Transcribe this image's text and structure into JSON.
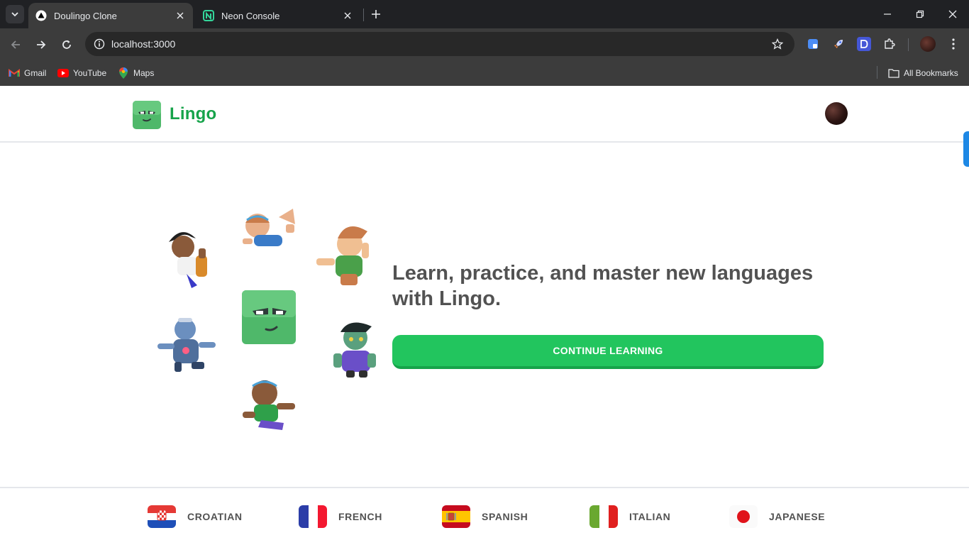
{
  "browser": {
    "tabs": [
      {
        "title": "Doulingo Clone",
        "active": true
      },
      {
        "title": "Neon Console",
        "active": false
      }
    ],
    "url": "localhost:3000",
    "bookmarks": [
      {
        "label": "Gmail",
        "icon": "gmail-icon"
      },
      {
        "label": "YouTube",
        "icon": "youtube-icon"
      },
      {
        "label": "Maps",
        "icon": "maps-icon"
      }
    ],
    "all_bookmarks_label": "All Bookmarks"
  },
  "header": {
    "logo_text": "Lingo"
  },
  "hero": {
    "headline": "Learn, practice, and master new languages with Lingo.",
    "cta_label": "CONTINUE LEARNING"
  },
  "footer": {
    "languages": [
      {
        "label": "CROATIAN",
        "flag": "croatia-flag"
      },
      {
        "label": "FRENCH",
        "flag": "france-flag"
      },
      {
        "label": "SPANISH",
        "flag": "spain-flag"
      },
      {
        "label": "ITALIAN",
        "flag": "italy-flag"
      },
      {
        "label": "JAPANESE",
        "flag": "japan-flag"
      }
    ]
  },
  "colors": {
    "brand_green": "#16a34a",
    "button_green": "#22c55e",
    "text_gray": "#525252",
    "chrome_dark": "#202124",
    "chrome_toolbar": "#3c3c3c"
  }
}
